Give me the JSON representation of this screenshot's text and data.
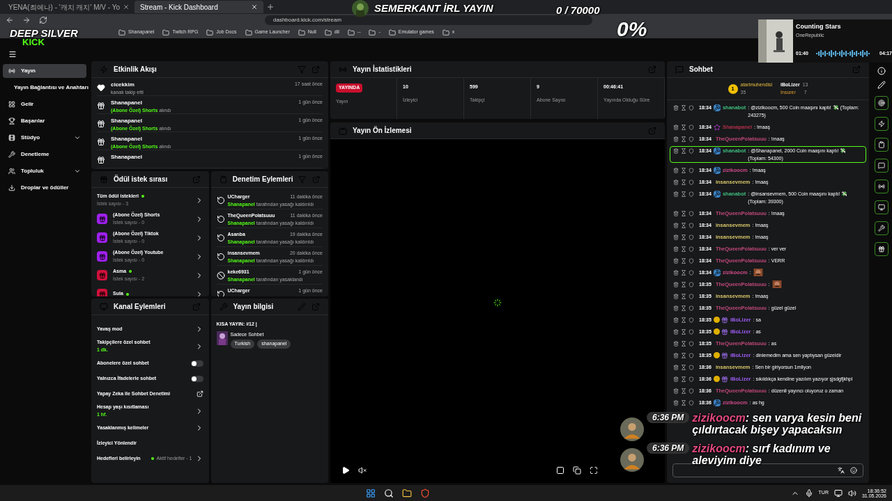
{
  "browser": {
    "tabs": [
      {
        "title": "YENA(최예나) - '캐치 캐치' M/V - Yo",
        "selected": false
      },
      {
        "title": "Stream - Kick Dashboard",
        "selected": true
      }
    ],
    "address": "dashboard.kick.com/stream",
    "bookmarks": [
      "Shanapanel",
      "Twitch RPG",
      "Job Docs",
      "Game Launcher",
      "Null",
      "dil",
      "--",
      "-",
      "Emulator games",
      "x"
    ]
  },
  "overlay": {
    "title": "SEMERKANT İRL YAYIN",
    "goal": "0 / 70000",
    "percent": "0%",
    "logo_top": "DEEP SILVER",
    "logo_bottom": "KICK",
    "music": {
      "title": "Counting Stars",
      "artist": "OneRepublic",
      "elapsed": "01:40",
      "total": "04:17"
    },
    "chat": [
      {
        "time": "6:36 PM",
        "user": "zizikoocm",
        "text": ": sen varya kesin beni çıldırtacak bişey yapacaksın"
      },
      {
        "time": "6:36 PM",
        "user": "zizikoocm",
        "text": ": sırf kadınım ve aleviyim diye"
      }
    ]
  },
  "sidebar": {
    "items": [
      {
        "label": "Yayın",
        "selected": true,
        "chevron": false
      },
      {
        "label": "Yayın Bağlantısı ve Anahtarı",
        "selected": false,
        "chevron": false
      },
      {
        "label": "Gelir",
        "selected": false,
        "chevron": false
      },
      {
        "label": "Başarılar",
        "selected": false,
        "chevron": false
      },
      {
        "label": "Stüdyo",
        "selected": false,
        "chevron": true
      },
      {
        "label": "Denetleme",
        "selected": false,
        "chevron": false
      },
      {
        "label": "Topluluk",
        "selected": false,
        "chevron": true
      },
      {
        "label": "Droplar ve ödüller",
        "selected": false,
        "chevron": false
      }
    ]
  },
  "activity": {
    "title": "Etkinlik Akışı",
    "items": [
      {
        "kind": "follow",
        "user": "cicekkim",
        "detail": "kanalı takip etti",
        "time": "17 saat önce"
      },
      {
        "kind": "reward",
        "user": "Shanapanel",
        "reward": "(Abone Özel) Shorts",
        "detail": "alındı",
        "time": "1 gün önce"
      },
      {
        "kind": "reward",
        "user": "Shanapanel",
        "reward": "(Abone Özel) Shorts",
        "detail": "alındı",
        "time": "1 gün önce"
      },
      {
        "kind": "reward",
        "user": "Shanapanel",
        "reward": "(Abone Özel) Shorts",
        "detail": "alındı",
        "time": "1 gün önce"
      },
      {
        "kind": "reward",
        "user": "Shanapanel",
        "time": "1 gün önce"
      }
    ]
  },
  "rewards": {
    "title": "Ödül istek sırası",
    "items": [
      {
        "kind": "all",
        "name": "Tüm ödül istekleri",
        "online": true,
        "count": "İstek sayısı - 3"
      },
      {
        "kind": "reward",
        "color": "#a020f0",
        "name": "(Abone Özel) Shorts",
        "online": false,
        "count": "İstek sayısı - 0"
      },
      {
        "kind": "reward",
        "color": "#a020f0",
        "name": "(Abone Özel) Tiktok",
        "online": false,
        "count": "İstek sayısı - 0"
      },
      {
        "kind": "reward",
        "color": "#a020f0",
        "name": "(Abone Özel) Youtube",
        "online": false,
        "count": "İstek sayısı - 0"
      },
      {
        "kind": "reward",
        "color": "#d0103a",
        "name": "Asma",
        "online": true,
        "count": "İstek sayısı - 2"
      },
      {
        "kind": "reward",
        "color": "#d0103a",
        "name": "Sula",
        "online": true
      }
    ]
  },
  "moderation": {
    "title": "Denetim Eylemleri",
    "items": [
      {
        "kind": "unban",
        "user": "UCharger",
        "actor": "Shanapanel",
        "action": "tarafından yasağı kaldırıldı",
        "time": "11 dakika önce"
      },
      {
        "kind": "unban",
        "user": "TheQueenPolatsuuu",
        "actor": "Shanapanel",
        "action": "tarafından yasağı kaldırıldı",
        "time": "11 dakika önce"
      },
      {
        "kind": "unban",
        "user": "Asanba",
        "actor": "Shanapanel",
        "action": "tarafından yasağı kaldırıldı",
        "time": "19 dakika önce"
      },
      {
        "kind": "unban",
        "user": "insansevmem",
        "actor": "Shanapanel",
        "action": "tarafından yasağı kaldırıldı",
        "time": "20 dakika önce"
      },
      {
        "kind": "ban",
        "user": "keke6931",
        "actor": "Shanapanel",
        "action": "tarafından yasaklandı",
        "time": "1 gün önce"
      },
      {
        "kind": "unban",
        "user": "UCharger",
        "time": "1 gün önce"
      }
    ]
  },
  "channel_actions": {
    "title": "Kanal Eylemleri",
    "items": [
      {
        "kind": "arrow",
        "label": "Yavaş mod"
      },
      {
        "kind": "arrow",
        "label": "Takipçilere özel sohbet",
        "sub": "1 dk."
      },
      {
        "kind": "toggle",
        "label": "Abonelere özel sohbet",
        "on": false
      },
      {
        "kind": "toggle",
        "label": "Yalnızca İfadelerle sohbet",
        "on": false
      },
      {
        "kind": "external",
        "label": "Yapay Zeka ile Sohbet Denetimi"
      },
      {
        "kind": "arrow",
        "label": "Hesap yaşı kısıtlaması",
        "sub": "1 hf."
      },
      {
        "kind": "arrow",
        "label": "Yasaklanmış kelimeler"
      },
      {
        "kind": "plain",
        "label": "İzleyici Yönlendir"
      },
      {
        "kind": "goal",
        "label": "Hedefleri belirleyin",
        "status": "Aktif hedefler - 1"
      }
    ]
  },
  "stream_info": {
    "title": "Yayın bilgisi",
    "stream_title": "KISA YAYIN: #12 |",
    "category": "Sadece Sohbet",
    "tags": [
      "Turkish",
      "shanapanel"
    ]
  },
  "stats": {
    "title": "Yayın İstatistikleri",
    "items": [
      {
        "kind": "live",
        "value": "YAYINDA",
        "label": "Yayın"
      },
      {
        "kind": "number",
        "value": "10",
        "label": "İzleyici"
      },
      {
        "kind": "number",
        "value": "599",
        "label": "Takipçi"
      },
      {
        "kind": "number",
        "value": "9",
        "label": "Abone Sayısı"
      },
      {
        "kind": "number",
        "value": "00:46:41",
        "label": "Yayında Olduğu Süre"
      }
    ]
  },
  "preview": {
    "title": "Yayın Ön İzlemesi"
  },
  "chat": {
    "title": "Sohbet",
    "leaders": [
      {
        "rank": "1",
        "user": "atarimuhendisi",
        "count": "35"
      },
      {
        "user": "iBoLizer",
        "count": "13"
      },
      {
        "user": "Insurer",
        "count": "7"
      }
    ],
    "messages": [
      {
        "time": "18:34",
        "kind": "bot",
        "user": "shanabot",
        "color": "#3fbf7f",
        "text": ": @zizikoocm, 500 Coin maaşını kaptı! 💸 (Toplam: 243275)",
        "emote": false,
        "highlighted": false
      },
      {
        "time": "18:34",
        "kind": "sub",
        "user": "Shanapanel",
        "color": "#b0304a",
        "text": ": !maaş",
        "emote": false,
        "highlighted": false
      },
      {
        "time": "18:34",
        "kind": "plain",
        "user": "TheQueenPolatsuuu",
        "color": "#c0487a",
        "text": ": !maaş",
        "emote": false,
        "highlighted": false
      },
      {
        "time": "18:34",
        "kind": "bot",
        "user": "shanabot",
        "color": "#3fbf7f",
        "text": ": @Shanapanel, 2000 Coin maaşını kaptı! 💸 (Toplam: 54300)",
        "emote": false,
        "highlighted": true
      },
      {
        "time": "18:34",
        "kind": "bot",
        "user": "zizikoocm",
        "color": "#d04a8a",
        "text": ": !maaş",
        "emote": false,
        "highlighted": false
      },
      {
        "time": "18:34",
        "kind": "plain",
        "user": "insansevmem",
        "color": "#d6c56a",
        "text": ": !maaş",
        "emote": false,
        "highlighted": false
      },
      {
        "time": "18:34",
        "kind": "bot",
        "user": "shanabot",
        "color": "#3fbf7f",
        "text": ": @insansevmem, 500 Coin maaşını kaptı! 💸 (Toplam: 39300)",
        "emote": false,
        "highlighted": false
      },
      {
        "time": "18:34",
        "kind": "plain",
        "user": "TheQueenPolatsuuu",
        "color": "#c0487a",
        "text": ": !maaş",
        "emote": false,
        "highlighted": false
      },
      {
        "time": "18:34",
        "kind": "plain",
        "user": "insansevmem",
        "color": "#d6c56a",
        "text": ": !maaş",
        "emote": false,
        "highlighted": false
      },
      {
        "time": "18:34",
        "kind": "plain",
        "user": "insansevmem",
        "color": "#d6c56a",
        "text": ": !maaş",
        "emote": false,
        "highlighted": false
      },
      {
        "time": "18:34",
        "kind": "plain",
        "user": "TheQueenPolatsuuu",
        "color": "#c0487a",
        "text": ": ver ver",
        "emote": false,
        "highlighted": false
      },
      {
        "time": "18:34",
        "kind": "plain",
        "user": "TheQueenPolatsuuu",
        "color": "#c0487a",
        "text": ": VERR",
        "emote": false,
        "highlighted": false
      },
      {
        "time": "18:34",
        "kind": "bot",
        "user": "zizikoocm",
        "color": "#d04a8a",
        "text": ":",
        "emote": true,
        "highlighted": false
      },
      {
        "time": "18:35",
        "kind": "plain",
        "user": "TheQueenPolatsuuu",
        "color": "#c0487a",
        "text": ":",
        "emote": true,
        "highlighted": false
      },
      {
        "time": "18:35",
        "kind": "plain",
        "user": "insansevmem",
        "color": "#d6c56a",
        "text": ": !maaş",
        "emote": false,
        "highlighted": false
      },
      {
        "time": "18:35",
        "kind": "plain",
        "user": "TheQueenPolatsuuu",
        "color": "#c0487a",
        "text": ": güzel güzel",
        "emote": false,
        "highlighted": false
      },
      {
        "time": "18:35",
        "kind": "coin",
        "user": "iBoLizer",
        "color": "#9b5cf0",
        "text": ": sa",
        "emote": false,
        "highlighted": false
      },
      {
        "time": "18:35",
        "kind": "coin",
        "user": "iBoLizer",
        "color": "#9b5cf0",
        "text": ": as",
        "emote": false,
        "highlighted": false
      },
      {
        "time": "18:35",
        "kind": "plain",
        "user": "TheQueenPolatsuuu",
        "color": "#c0487a",
        "text": ": as",
        "emote": false,
        "highlighted": false
      },
      {
        "time": "18:35",
        "kind": "coin",
        "user": "iBoLizer",
        "color": "#9b5cf0",
        "text": ": dinlemedim ama sen yaptıysan güzeldir",
        "emote": false,
        "highlighted": false
      },
      {
        "time": "18:36",
        "kind": "plain",
        "user": "insansevmem",
        "color": "#d6c56a",
        "text": ": Sen bir giriyorsun 1milyon",
        "emote": false,
        "highlighted": false
      },
      {
        "time": "18:36",
        "kind": "coin",
        "user": "iBoLizer",
        "color": "#9b5cf0",
        "text": ": sıkıldıkça kendine yazılım yazıyor şjsdgfjkhpl",
        "emote": false,
        "highlighted": false
      },
      {
        "time": "18:36",
        "kind": "plain",
        "user": "TheQueenPolatsuuu",
        "color": "#c0487a",
        "text": ": düzenli yayıncı oluyoruz o zaman",
        "emote": false,
        "highlighted": false
      },
      {
        "time": "18:36",
        "kind": "bot",
        "user": "zizikoocm",
        "color": "#d04a8a",
        "text": ": as hg",
        "emote": false,
        "highlighted": false
      }
    ]
  },
  "taskbar": {
    "language": "TUR",
    "time": "18:36:52",
    "date": "31.05.2026"
  }
}
